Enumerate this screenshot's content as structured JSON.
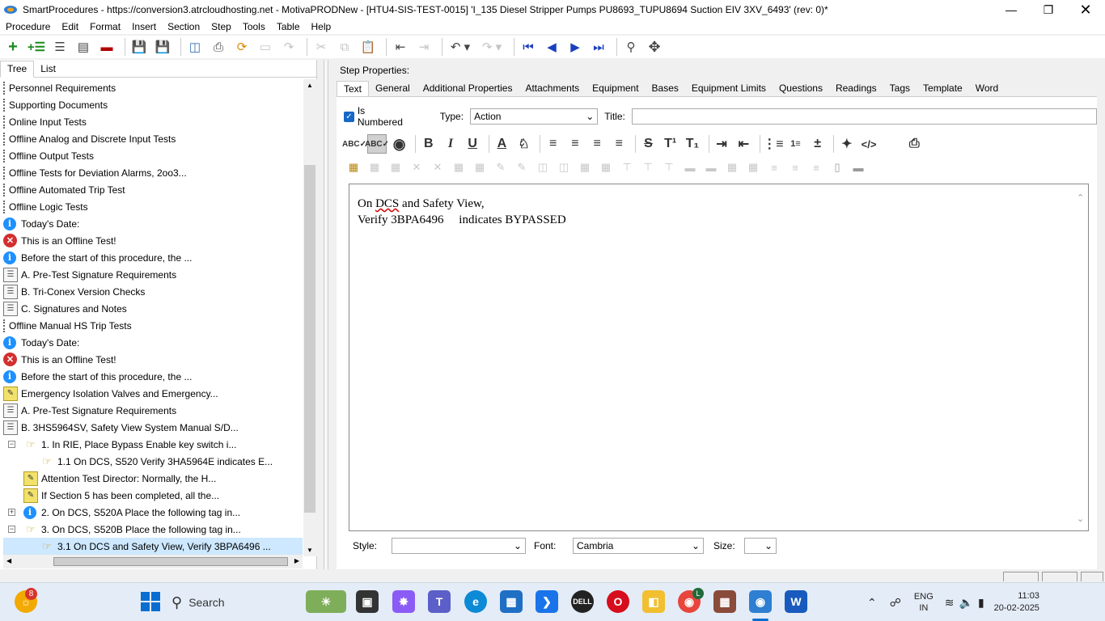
{
  "window": {
    "title": "SmartProcedures - https://conversion3.atrcloudhosting.net - MotivaPRODNew - [HTU4-SIS-TEST-0015] 'I_135 Diesel Stripper Pumps PU8693_TUPU8694 Suction EIV 3XV_6493' (rev: 0)*"
  },
  "menu": [
    "Procedure",
    "Edit",
    "Format",
    "Insert",
    "Section",
    "Step",
    "Tools",
    "Table",
    "Help"
  ],
  "left_tabs": [
    "Tree",
    "List"
  ],
  "tree": [
    {
      "icon": "bar",
      "label": "Personnel Requirements",
      "indent": 0
    },
    {
      "icon": "bar",
      "label": "Supporting Documents",
      "indent": 0
    },
    {
      "icon": "bar",
      "label": "Online Input Tests",
      "indent": 0
    },
    {
      "icon": "bar",
      "label": "Offline Analog and Discrete Input Tests",
      "indent": 0
    },
    {
      "icon": "bar",
      "label": "Offline Output Tests",
      "indent": 0
    },
    {
      "icon": "bar",
      "label": "Offline Tests for Deviation Alarms, 2oo3...",
      "indent": 0
    },
    {
      "icon": "bar",
      "label": "Offline Automated Trip Test",
      "indent": 0
    },
    {
      "icon": "bar",
      "label": "Offline Logic Tests",
      "indent": 0
    },
    {
      "icon": "info",
      "label": "Today's Date:",
      "indent": 0
    },
    {
      "icon": "err",
      "label": "This is an Offline Test!",
      "indent": 0
    },
    {
      "icon": "info",
      "label": "Before the start of this procedure, the ...",
      "indent": 0
    },
    {
      "icon": "doc",
      "label": "A. Pre-Test Signature Requirements",
      "indent": 0
    },
    {
      "icon": "doc",
      "label": "B. Tri-Conex Version Checks",
      "indent": 0
    },
    {
      "icon": "doc",
      "label": "C. Signatures and Notes",
      "indent": 0
    },
    {
      "icon": "bar",
      "label": "Offline Manual HS Trip Tests",
      "indent": 0
    },
    {
      "icon": "info",
      "label": "Today's Date:",
      "indent": 0
    },
    {
      "icon": "err",
      "label": "This is an Offline Test!",
      "indent": 0
    },
    {
      "icon": "info",
      "label": "Before the start of this procedure, the ...",
      "indent": 0
    },
    {
      "icon": "note",
      "label": "Emergency Isolation Valves and Emergency...",
      "indent": 0
    },
    {
      "icon": "doc",
      "label": "A. Pre-Test Signature Requirements",
      "indent": 0
    },
    {
      "icon": "doc",
      "label": "B. 3HS5964SV, Safety View System Manual S/D...",
      "indent": 0
    },
    {
      "icon": "hand",
      "label": "1. In RIE, Place Bypass Enable key switch i...",
      "indent": 1,
      "exp": "−"
    },
    {
      "icon": "hand",
      "label": "1.1 On DCS, S520 Verify 3HA5964E indicates E...",
      "indent": 2
    },
    {
      "icon": "note",
      "label": "Attention Test Director: Normally, the H...",
      "indent": 1
    },
    {
      "icon": "note",
      "label": "If Section 5 has been completed, all the...",
      "indent": 1
    },
    {
      "icon": "info",
      "label": "2. On DCS, S520A Place the following tag in...",
      "indent": 1,
      "exp": "+"
    },
    {
      "icon": "hand",
      "label": "3. On DCS, S520B Place the following tag in...",
      "indent": 1,
      "exp": "−"
    },
    {
      "icon": "hand",
      "label": "3.1 On DCS and Safety View, Verify 3BPA6496 ...",
      "indent": 2,
      "selected": true
    }
  ],
  "step_properties": {
    "heading": "Step Properties:",
    "tabs": [
      "Text",
      "General",
      "Additional Properties",
      "Attachments",
      "Equipment",
      "Bases",
      "Equipment Limits",
      "Questions",
      "Readings",
      "Tags",
      "Template",
      "Word"
    ],
    "is_numbered_label": "Is Numbered",
    "type_label": "Type:",
    "type_value": "Action",
    "title_label": "Title:",
    "title_value": ""
  },
  "editor": {
    "line1_prefix": "On ",
    "line1_squiggle": "DCS",
    "line1_rest": " and Safety View,",
    "line2": "Verify 3BPA6496     indicates BYPASSED"
  },
  "bottom": {
    "style_label": "Style:",
    "style_value": "",
    "font_label": "Font:",
    "font_value": "Cambria",
    "size_label": "Size:",
    "size_value": ""
  },
  "taskbar": {
    "notification_count": "8",
    "search_label": "Search",
    "chrome_badge": "L",
    "lang_top": "ENG",
    "lang_bottom": "IN",
    "time": "11:03",
    "date": "20-02-2025"
  },
  "colors": {
    "selection": "#cde8ff",
    "checkbox": "#1667c7",
    "nav_blue": "#1a3fbf"
  }
}
